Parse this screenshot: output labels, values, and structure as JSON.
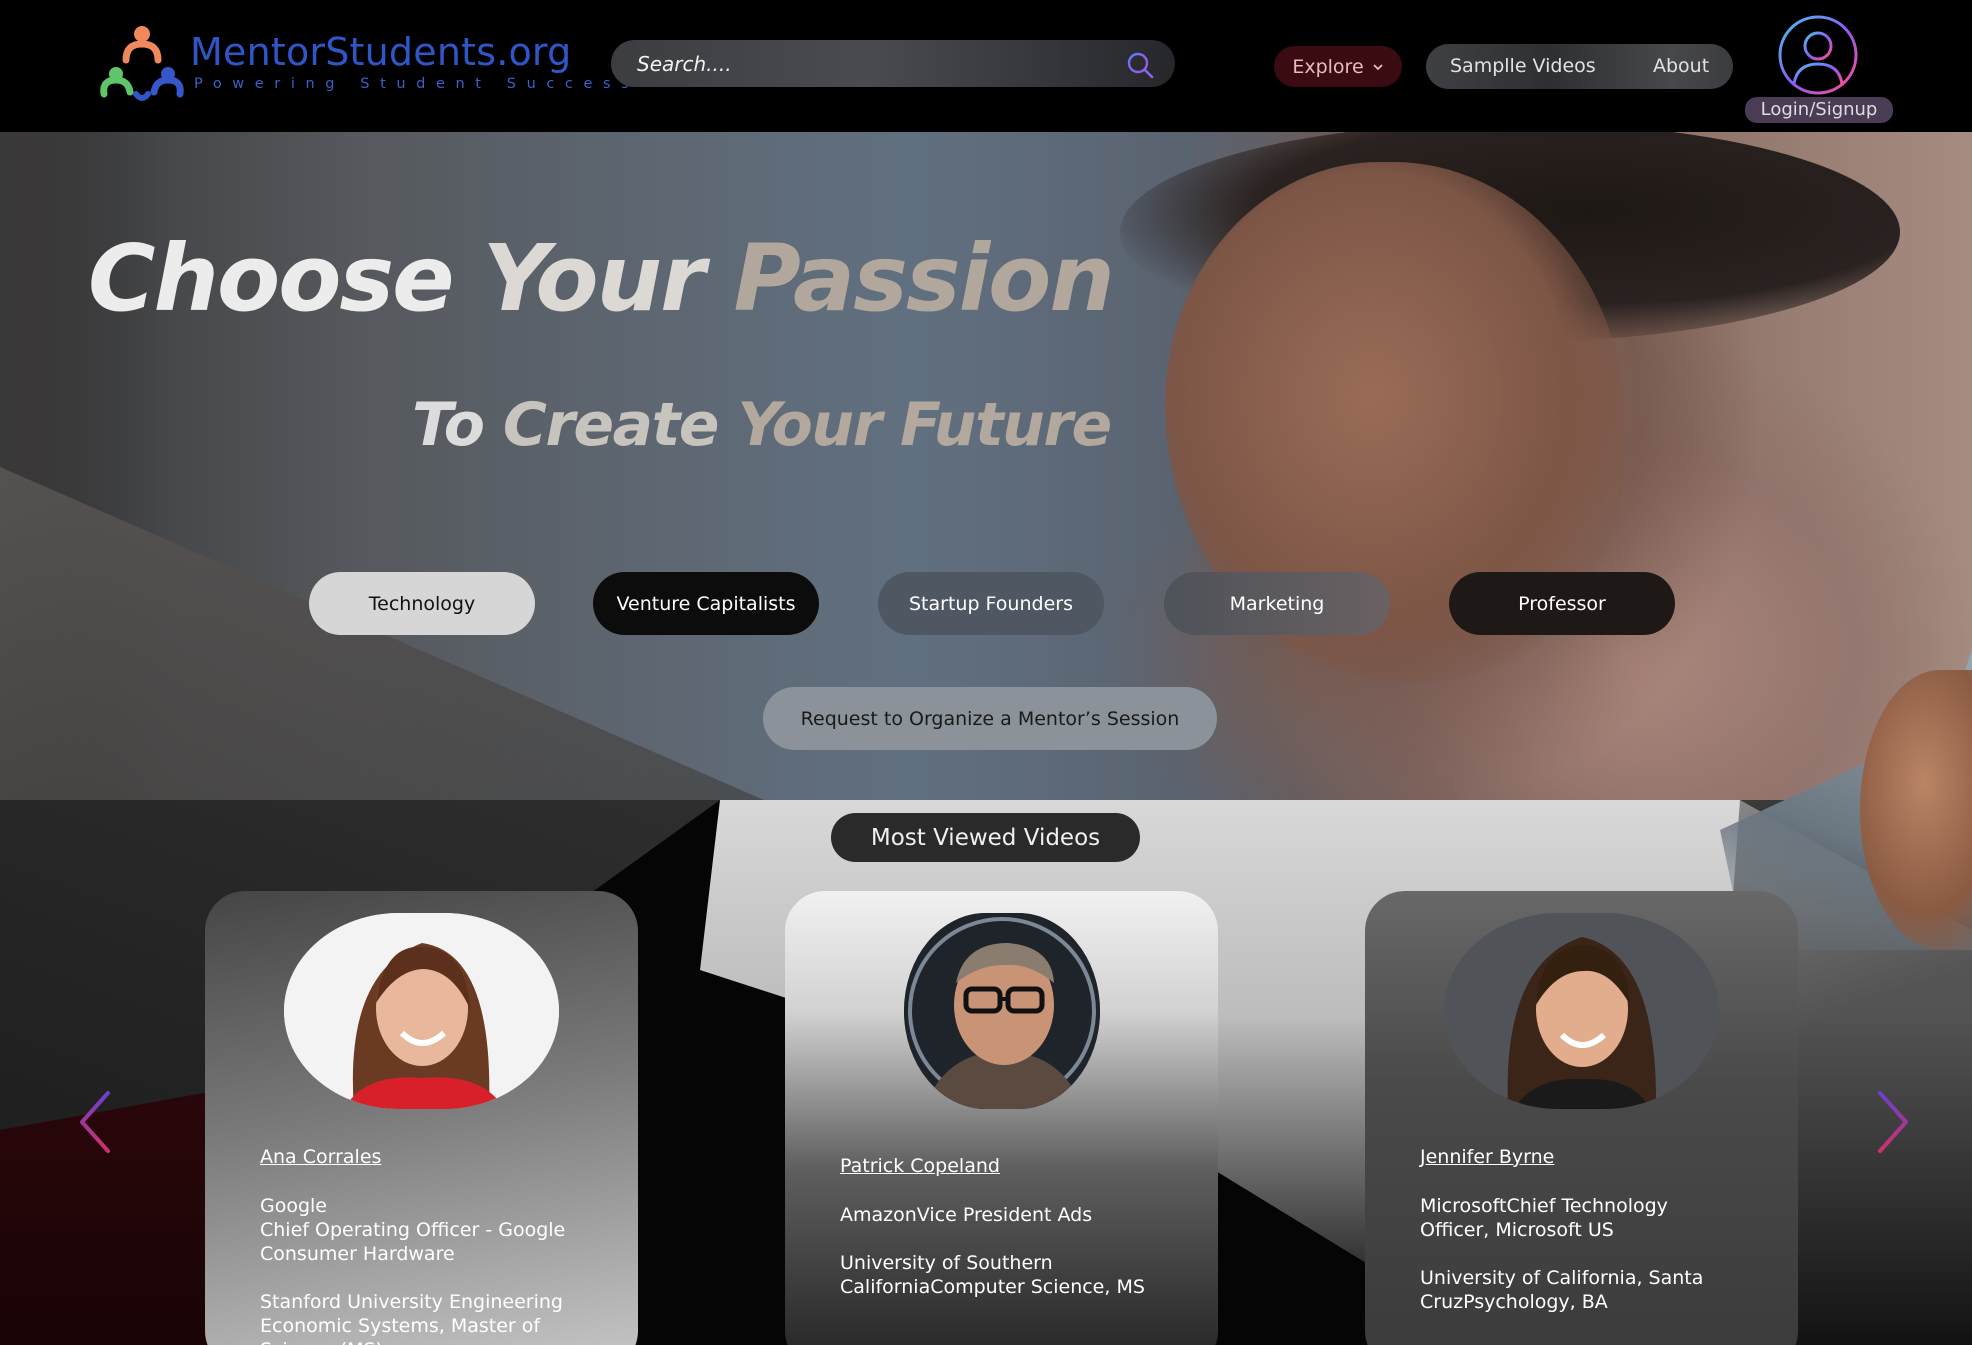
{
  "brand": {
    "name": "MentorStudents.org",
    "tagline": "Powering Student Success"
  },
  "search": {
    "placeholder": "Search...."
  },
  "nav": {
    "explore_label": "Explore",
    "sample_videos_label": "Samplle Videos",
    "about_label": "About",
    "login_label": "Login/Signup"
  },
  "hero": {
    "title_word1": "Choose",
    "title_word2": "Your",
    "title_word3": "Passion",
    "subtitle_part1": "To",
    "subtitle_part2": "Create",
    "subtitle_part3": "Your Future"
  },
  "categories": [
    {
      "label": "Technology",
      "selected": true
    },
    {
      "label": "Venture Capitalists",
      "selected": false
    },
    {
      "label": "Startup Founders",
      "selected": false
    },
    {
      "label": "Marketing",
      "selected": false
    },
    {
      "label": "Professor",
      "selected": false
    }
  ],
  "request_button": "Request to Organize a Mentor’s Session",
  "most_viewed": {
    "heading": "Most Viewed Videos",
    "cards": [
      {
        "name": "Ana Corrales",
        "company": "Google",
        "role": "Chief Operating Officer - Google Consumer Hardware",
        "education": "Stanford University Engineering Economic Systems, Master of Science (MS)"
      },
      {
        "name": "Patrick Copeland",
        "company_role": "AmazonVice President Ads",
        "education": "University of Southern CaliforniaComputer Science, MS"
      },
      {
        "name": "Jennifer Byrne",
        "company_role": "MicrosoftChief Technology Officer, Microsoft US",
        "education": "University of California, Santa CruzPsychology, BA"
      }
    ]
  },
  "colors": {
    "brand_blue": "#2f56c7",
    "explore_bg": "#3a0b10",
    "arrow_gradient_start": "#6b3fd0",
    "arrow_gradient_end": "#d0306a"
  }
}
